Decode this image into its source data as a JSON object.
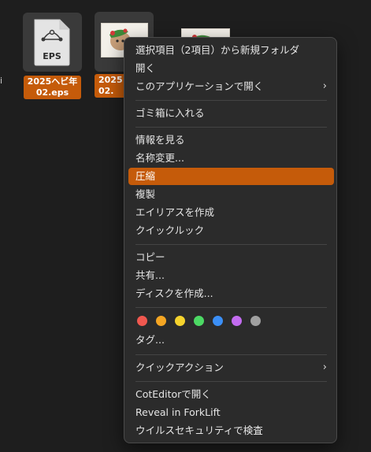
{
  "background_color": "#1e1e1e",
  "accent_color": "#c55b0a",
  "files": [
    {
      "icon": "eps-document-icon",
      "badge": "EPS",
      "name_line1": "2025ヘビ年",
      "name_line2": "02.eps",
      "selected": true
    },
    {
      "icon": "image-thumbnail-icon",
      "name_line1": "2025",
      "name_line2": "02.",
      "selected": true
    },
    {
      "icon": "image-thumbnail-icon",
      "selected": false
    }
  ],
  "left_stray_text": "i",
  "context_menu": {
    "groups": [
      [
        {
          "label": "選択項目（2項目）から新規フォルダ"
        },
        {
          "label": "開く"
        },
        {
          "label": "このアプリケーションで開く",
          "submenu": true
        }
      ],
      [
        {
          "label": "ゴミ箱に入れる"
        }
      ],
      [
        {
          "label": "情報を見る"
        },
        {
          "label": "名称変更..."
        },
        {
          "label": "圧縮",
          "highlighted": true
        },
        {
          "label": "複製"
        },
        {
          "label": "エイリアスを作成"
        },
        {
          "label": "クイックルック"
        }
      ],
      [
        {
          "label": "コピー"
        },
        {
          "label": "共有..."
        },
        {
          "label": "ディスクを作成..."
        }
      ],
      [
        {
          "label": "タグ..."
        }
      ],
      [
        {
          "label": "クイックアクション",
          "submenu": true
        }
      ],
      [
        {
          "label": "CotEditorで開く"
        },
        {
          "label": "Reveal in ForkLift"
        },
        {
          "label": "ウイルスセキュリティで検査"
        }
      ]
    ],
    "tag_colors": [
      {
        "name": "red",
        "color": "#f0584f"
      },
      {
        "name": "orange",
        "color": "#f5a623"
      },
      {
        "name": "yellow",
        "color": "#f6d32d"
      },
      {
        "name": "green",
        "color": "#4cd964"
      },
      {
        "name": "blue",
        "color": "#3b8ff6"
      },
      {
        "name": "purple",
        "color": "#c36cf0"
      },
      {
        "name": "gray",
        "color": "#a0a0a0"
      }
    ],
    "submenu_chevron": "›"
  }
}
